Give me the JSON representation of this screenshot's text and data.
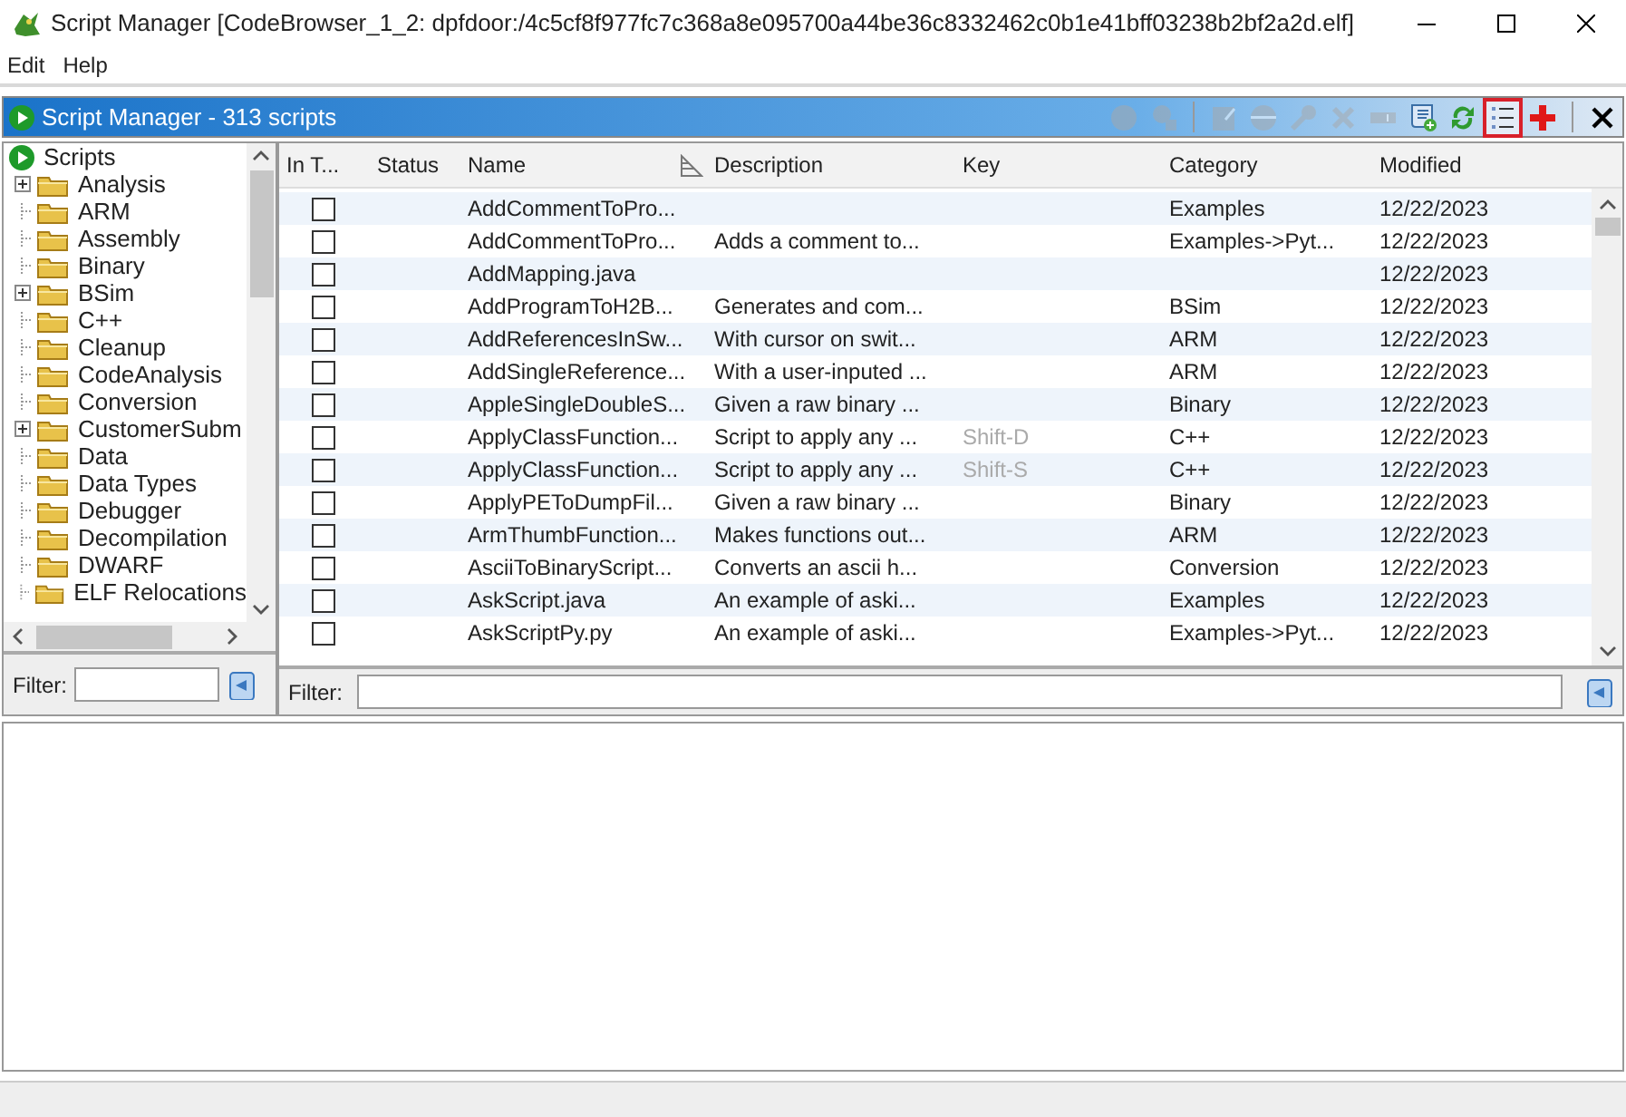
{
  "window": {
    "title": "Script Manager [CodeBrowser_1_2: dpfdoor:/4c5cf8f977fc7c368a8e095700a44be36c8332462c0b1e41bff03238b2bf2a2d.elf]"
  },
  "menu": [
    "Edit",
    "Help"
  ],
  "panel": {
    "title": "Script Manager - 313 scripts"
  },
  "toolbar": [
    {
      "kind": "run",
      "enabled": false,
      "highlighted": false
    },
    {
      "kind": "step",
      "enabled": false,
      "highlighted": false
    },
    {
      "kind": "sep"
    },
    {
      "kind": "edit",
      "enabled": false,
      "highlighted": false
    },
    {
      "kind": "disc",
      "enabled": false,
      "highlighted": false
    },
    {
      "kind": "key",
      "enabled": false,
      "highlighted": false
    },
    {
      "kind": "delete",
      "enabled": false,
      "highlighted": false
    },
    {
      "kind": "rename",
      "enabled": false,
      "highlighted": false
    },
    {
      "kind": "newscript",
      "enabled": true,
      "highlighted": false
    },
    {
      "kind": "refresh",
      "enabled": true,
      "highlighted": false
    },
    {
      "kind": "list",
      "enabled": true,
      "highlighted": true
    },
    {
      "kind": "add",
      "enabled": true,
      "highlighted": false
    },
    {
      "kind": "sep"
    },
    {
      "kind": "close",
      "enabled": true,
      "highlighted": false
    }
  ],
  "tree": {
    "root": "Scripts",
    "children": [
      {
        "label": "Analysis",
        "expandable": true
      },
      {
        "label": "ARM",
        "expandable": false
      },
      {
        "label": "Assembly",
        "expandable": false
      },
      {
        "label": "Binary",
        "expandable": false
      },
      {
        "label": "BSim",
        "expandable": true
      },
      {
        "label": "C++",
        "expandable": false
      },
      {
        "label": "Cleanup",
        "expandable": false
      },
      {
        "label": "CodeAnalysis",
        "expandable": false
      },
      {
        "label": "Conversion",
        "expandable": false
      },
      {
        "label": "CustomerSubm",
        "expandable": true
      },
      {
        "label": "Data",
        "expandable": false
      },
      {
        "label": "Data Types",
        "expandable": false
      },
      {
        "label": "Debugger",
        "expandable": false
      },
      {
        "label": "Decompilation",
        "expandable": false
      },
      {
        "label": "DWARF",
        "expandable": false
      },
      {
        "label": "ELF Relocations",
        "expandable": false
      }
    ]
  },
  "tree_filter": {
    "label": "Filter:"
  },
  "table": {
    "columns": [
      "In T...",
      "Status",
      "Name",
      "Description",
      "Key",
      "Category",
      "Modified"
    ],
    "rows": [
      {
        "checked": false,
        "name": "AddCommentToPro...",
        "description": "",
        "key": "",
        "category": "Examples",
        "modified": "12/22/2023"
      },
      {
        "checked": false,
        "name": "AddCommentToPro...",
        "description": "Adds a comment to...",
        "key": "",
        "category": "Examples->Pyt...",
        "modified": "12/22/2023"
      },
      {
        "checked": false,
        "name": "AddMapping.java",
        "description": "",
        "key": "",
        "category": "",
        "modified": "12/22/2023"
      },
      {
        "checked": false,
        "name": "AddProgramToH2B...",
        "description": "Generates and com...",
        "key": "",
        "category": "BSim",
        "modified": "12/22/2023"
      },
      {
        "checked": false,
        "name": "AddReferencesInSw...",
        "description": "With cursor on swit...",
        "key": "",
        "category": "ARM",
        "modified": "12/22/2023"
      },
      {
        "checked": false,
        "name": "AddSingleReference...",
        "description": "With a user-inputed ...",
        "key": "",
        "category": "ARM",
        "modified": "12/22/2023"
      },
      {
        "checked": false,
        "name": "AppleSingleDoubleS...",
        "description": "Given a raw binary ...",
        "key": "",
        "category": "Binary",
        "modified": "12/22/2023"
      },
      {
        "checked": false,
        "name": "ApplyClassFunction...",
        "description": "Script to apply any ...",
        "key": "Shift-D",
        "category": "C++",
        "modified": "12/22/2023"
      },
      {
        "checked": false,
        "name": "ApplyClassFunction...",
        "description": "Script to apply any ...",
        "key": "Shift-S",
        "category": "C++",
        "modified": "12/22/2023"
      },
      {
        "checked": false,
        "name": "ApplyPEToDumpFil...",
        "description": "Given a raw binary ...",
        "key": "",
        "category": "Binary",
        "modified": "12/22/2023"
      },
      {
        "checked": false,
        "name": "ArmThumbFunction...",
        "description": "Makes functions out...",
        "key": "",
        "category": "ARM",
        "modified": "12/22/2023"
      },
      {
        "checked": false,
        "name": "AsciiToBinaryScript...",
        "description": "Converts an ascii h...",
        "key": "",
        "category": "Conversion",
        "modified": "12/22/2023"
      },
      {
        "checked": false,
        "name": "AskScript.java",
        "description": "An example of aski...",
        "key": "",
        "category": "Examples",
        "modified": "12/22/2023"
      },
      {
        "checked": false,
        "name": "AskScriptPy.py",
        "description": "An example of aski...",
        "key": "",
        "category": "Examples->Pyt...",
        "modified": "12/22/2023"
      }
    ]
  },
  "table_filter": {
    "label": "Filter:"
  }
}
